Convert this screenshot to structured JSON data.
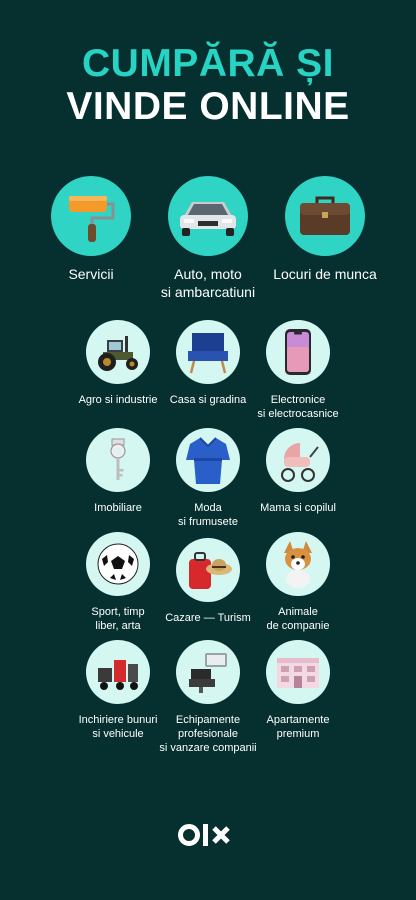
{
  "headline": {
    "line1": "CUMPĂRĂ ȘI",
    "line2": "VINDE ONLINE"
  },
  "top_categories": [
    {
      "icon": "paint-roller-icon",
      "label_lines": [
        "Servicii"
      ]
    },
    {
      "icon": "car-icon",
      "label_lines": [
        "Auto, moto",
        "si ambarcatiuni"
      ]
    },
    {
      "icon": "briefcase-icon",
      "label_lines": [
        "Locuri de munca"
      ]
    }
  ],
  "categories": [
    {
      "icon": "tractor-icon",
      "label_lines": [
        "Agro si industrie"
      ]
    },
    {
      "icon": "armchair-icon",
      "label_lines": [
        "Casa si gradina"
      ]
    },
    {
      "icon": "smartphone-icon",
      "label_lines": [
        "Electronice",
        "si electrocasnice"
      ]
    },
    {
      "icon": "key-icon",
      "label_lines": [
        "Imobiliare"
      ]
    },
    {
      "icon": "robe-icon",
      "label_lines": [
        "Moda",
        "si frumusete"
      ]
    },
    {
      "icon": "stroller-icon",
      "label_lines": [
        "Mama si copilul"
      ]
    },
    {
      "icon": "soccer-ball-icon",
      "label_lines": [
        "Sport, timp",
        "liber, arta"
      ]
    },
    {
      "icon": "suitcase-hat-icon",
      "label_lines": [
        "Cazare — Turism"
      ]
    },
    {
      "icon": "dog-icon",
      "label_lines": [
        "Animale",
        "de companie"
      ]
    },
    {
      "icon": "equipment-icon",
      "label_lines": [
        "Inchiriere bunuri",
        "si vehicule"
      ]
    },
    {
      "icon": "salon-chair-icon",
      "label_lines": [
        "Echipamente",
        "profesionale",
        "si vanzare companii"
      ]
    },
    {
      "icon": "apartment-building-icon",
      "label_lines": [
        "Apartamente",
        "premium"
      ]
    }
  ],
  "brand": {
    "logo_text": "OLX"
  },
  "colors": {
    "background": "#05302f",
    "accent": "#27d3c3",
    "circle": "#d4f7f2"
  }
}
